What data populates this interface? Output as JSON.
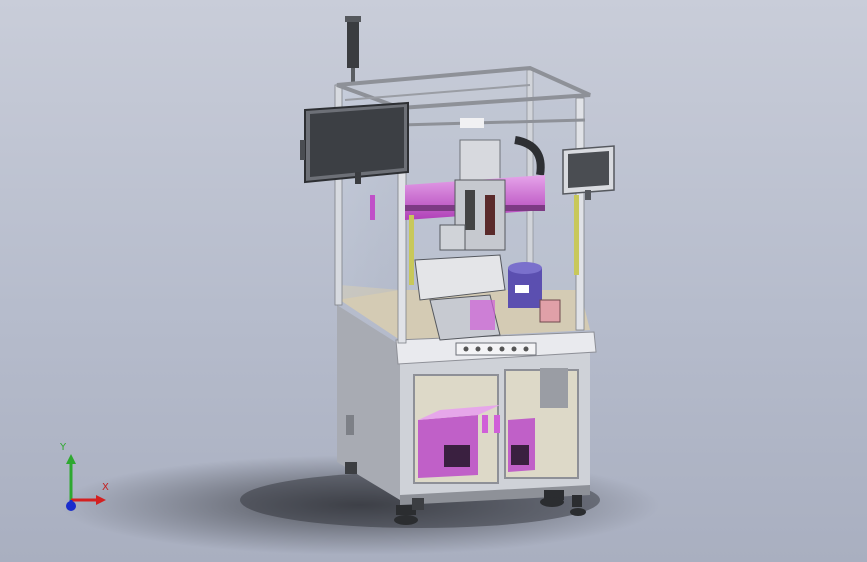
{
  "scene": {
    "description_free": true,
    "colors": {
      "background_top": "#c9cdd9",
      "background_bottom": "#a9afc0",
      "frame": "#d8dbe0",
      "panel": "#b7bac2",
      "accent_magenta": "#c050c8",
      "accent_yellow": "#c8c85a",
      "table_top": "#d6cdb8",
      "screen": "#3c3f44",
      "purple_box": "#5b4fb0"
    }
  },
  "triad": {
    "x_label": "X",
    "y_label": "Y"
  }
}
